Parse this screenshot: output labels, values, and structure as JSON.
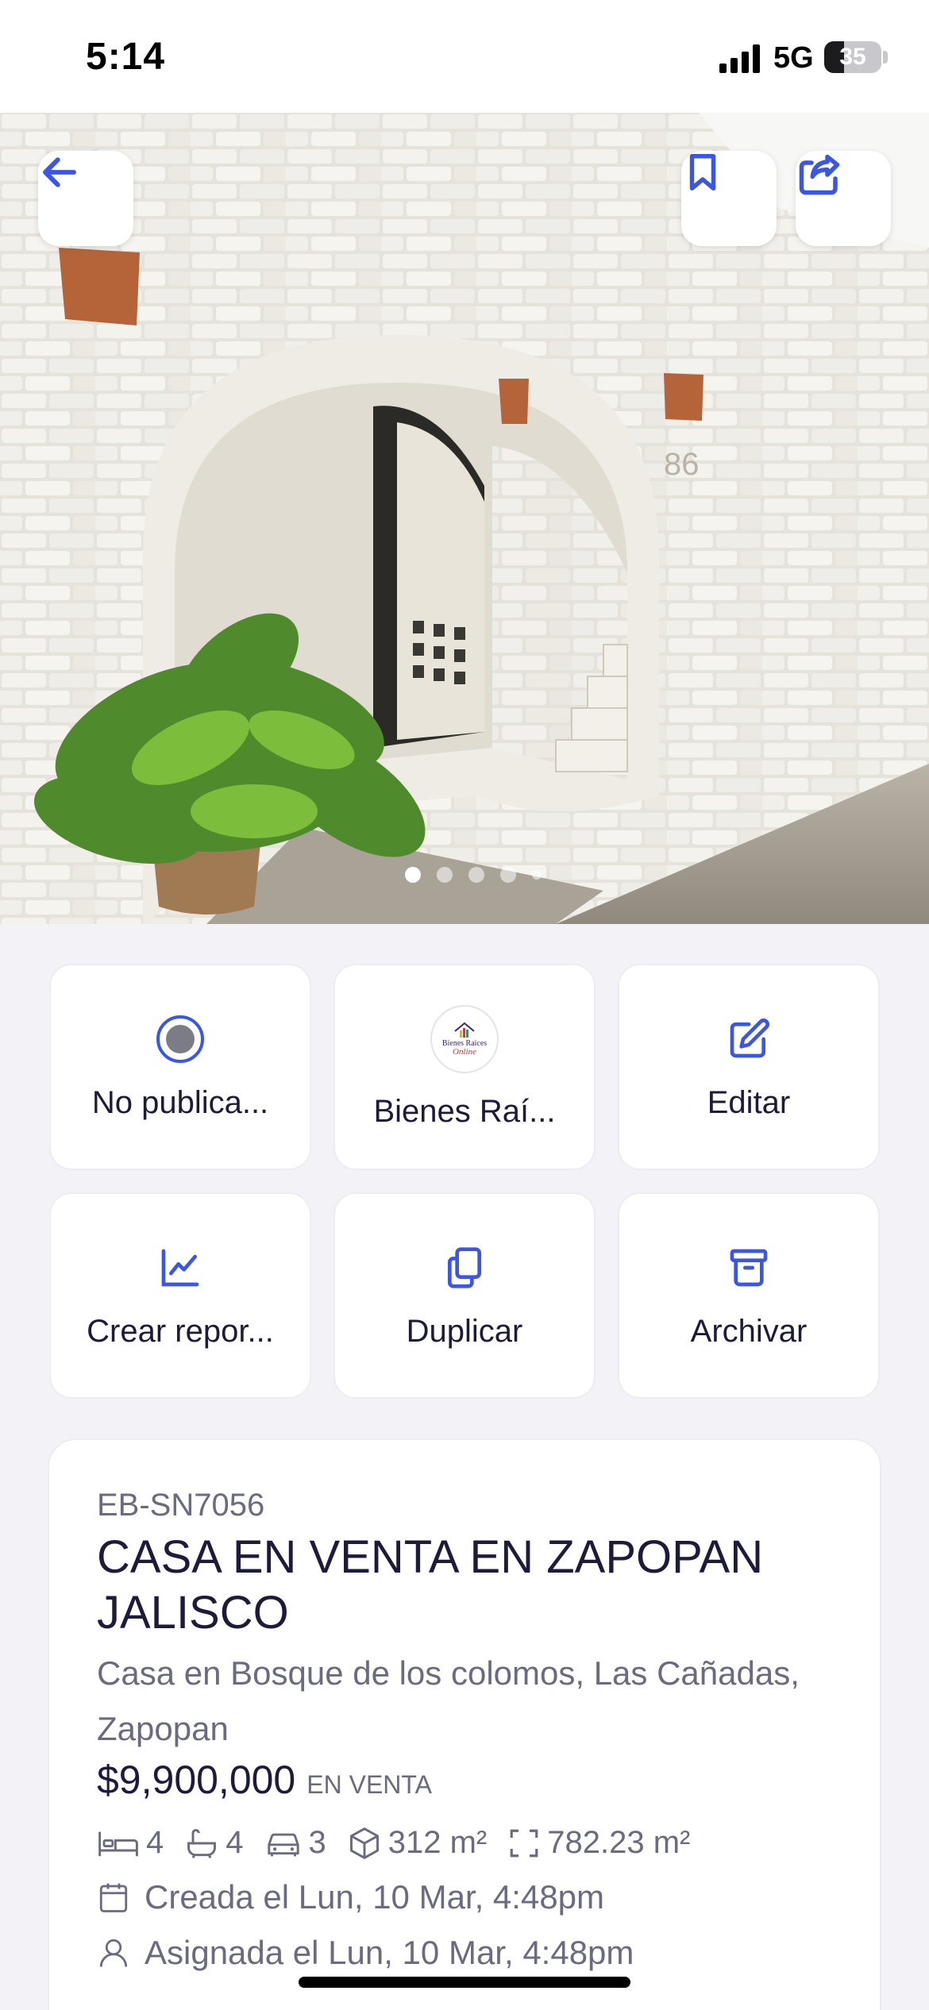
{
  "status_bar": {
    "time": "5:14",
    "network": "5G",
    "battery": "35",
    "battery_level": 0.35
  },
  "hero": {
    "photo_count": 5,
    "active_index": 0
  },
  "actions": [
    {
      "label": "No publica...",
      "icon": "radio-selected-icon"
    },
    {
      "label": "Bienes Raí...",
      "icon": "agency-logo"
    },
    {
      "label": "Editar",
      "icon": "edit-icon"
    },
    {
      "label": "Crear repor...",
      "icon": "chart-line-icon"
    },
    {
      "label": "Duplicar",
      "icon": "copy-icon"
    },
    {
      "label": "Archivar",
      "icon": "archive-icon"
    }
  ],
  "logo": {
    "line1": "Bienes Raices",
    "line2": "Online"
  },
  "property": {
    "code": "EB-SN7056",
    "title": "CASA EN VENTA EN ZAPOPAN JALISCO",
    "address": "Casa en Bosque de los colomos, Las Cañadas, Zapopan",
    "price": "$9,900,000",
    "status": "EN VENTA",
    "bedrooms": "4",
    "bathrooms": "4",
    "parking": "3",
    "built_area": "312 m²",
    "lot_area": "782.23 m²",
    "created": "Creada el Lun, 10 Mar, 4:48pm",
    "assigned": "Asignada el Lun, 10 Mar, 4:48pm"
  },
  "colors": {
    "accent": "#3b55e6",
    "background": "#f2f2f7",
    "text": "#1d1b3a",
    "muted": "#6b6b80"
  }
}
